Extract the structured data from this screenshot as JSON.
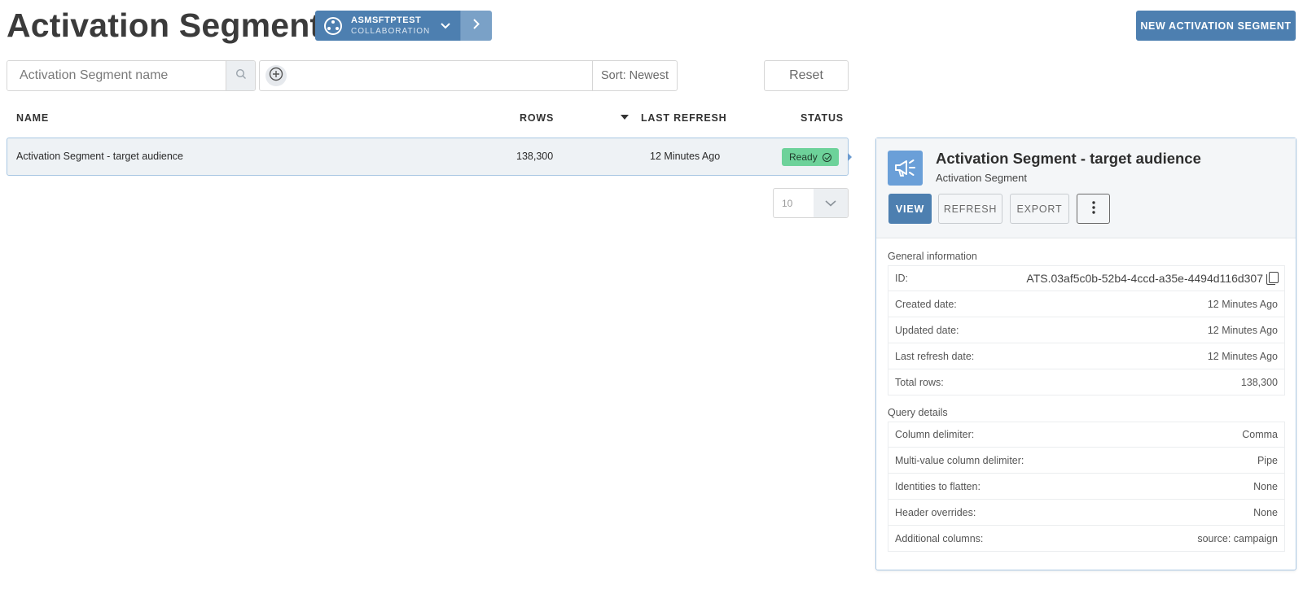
{
  "page": {
    "title": "Activation Segments",
    "new_button_label": "NEW ACTIVATION SEGMENT"
  },
  "collaboration": {
    "name": "ASMSFTPTEST",
    "sub": "COLLABORATION"
  },
  "filters": {
    "search_placeholder": "Activation Segment name",
    "sort_label": "Sort: Newest",
    "reset_label": "Reset"
  },
  "table": {
    "headers": {
      "name": "NAME",
      "rows": "ROWS",
      "last_refresh": "LAST REFRESH",
      "status": "STATUS"
    },
    "rows": [
      {
        "name": "Activation Segment - target audience",
        "rows": "138,300",
        "last_refresh": "12 Minutes Ago",
        "status": "Ready"
      }
    ],
    "page_size": "10"
  },
  "detail": {
    "title": "Activation Segment - target audience",
    "subtitle": "Activation Segment",
    "buttons": {
      "view": "VIEW",
      "refresh": "REFRESH",
      "export": "EXPORT"
    },
    "general_label": "General information",
    "general": [
      {
        "key": "ID:",
        "value": "ATS.03af5c0b-52b4-4ccd-a35e-4494d116d307"
      },
      {
        "key": "Created date:",
        "value": "12 Minutes Ago"
      },
      {
        "key": "Updated date:",
        "value": "12 Minutes Ago"
      },
      {
        "key": "Last refresh date:",
        "value": "12 Minutes Ago"
      },
      {
        "key": "Total rows:",
        "value": "138,300"
      }
    ],
    "query_label": "Query details",
    "query": [
      {
        "key": "Column delimiter:",
        "value": "Comma"
      },
      {
        "key": "Multi-value column delimiter:",
        "value": "Pipe"
      },
      {
        "key": "Identities to flatten:",
        "value": "None"
      },
      {
        "key": "Header overrides:",
        "value": "None"
      },
      {
        "key": "Additional columns:",
        "value": "source: campaign"
      }
    ]
  },
  "colors": {
    "primary": "#4d7fb0",
    "status_ready": "#6dd29a",
    "panel_icon": "#6a9fd8"
  },
  "icons": {
    "collaboration": "collaboration-icon",
    "search": "search-icon",
    "add_filter": "plus-circle-icon",
    "panel": "megaphone-icon",
    "more": "more-vertical-icon",
    "copy": "copy-icon"
  }
}
